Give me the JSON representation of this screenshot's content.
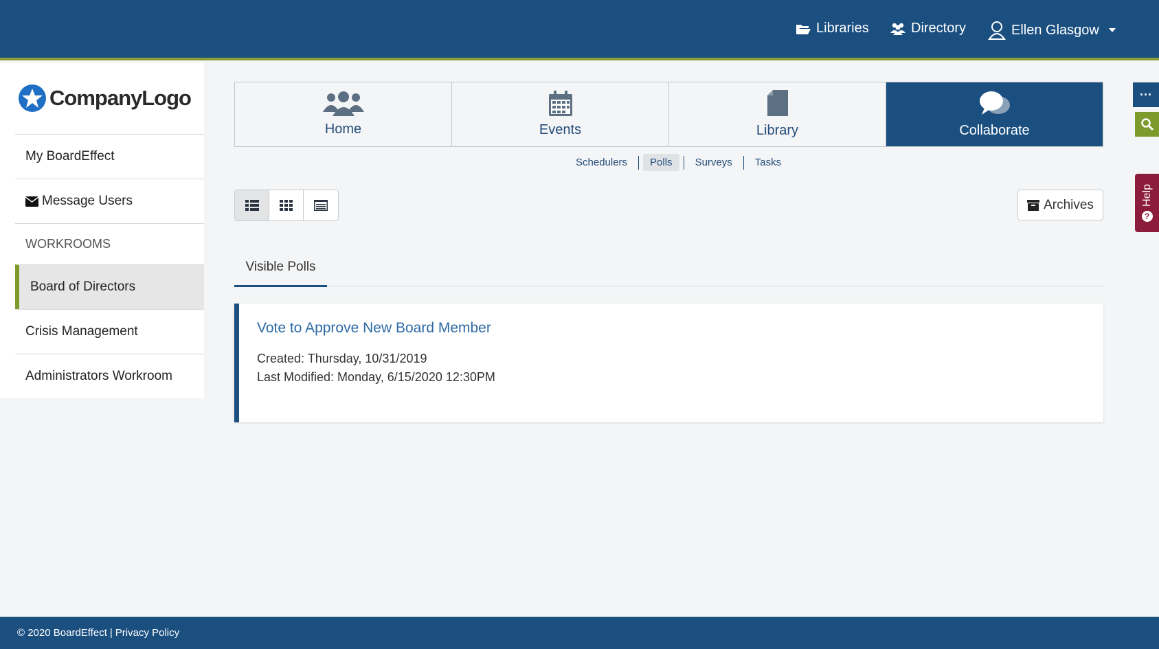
{
  "colors": {
    "brand_blue": "#1b4f80",
    "accent_green": "#7d9a2c",
    "help_red": "#8c1d3a",
    "link_blue": "#2d6aa6"
  },
  "header": {
    "libraries_label": "Libraries",
    "libraries_icon": "folder-open-icon",
    "directory_label": "Directory",
    "directory_icon": "users-icon",
    "user_name": "Ellen Glasgow",
    "user_icon": "user-outline-icon"
  },
  "sidebar": {
    "logo_text": "CompanyLogo",
    "my_boardeffect": "My BoardEffect",
    "message_users": "Message Users",
    "workrooms_heading": "WORKROOMS",
    "workrooms": [
      {
        "label": "Board of Directors",
        "active": true
      },
      {
        "label": "Crisis Management",
        "active": false
      },
      {
        "label": "Administrators Workroom",
        "active": false
      }
    ]
  },
  "main_tabs": [
    {
      "label": "Home",
      "icon": "group-icon",
      "active": false
    },
    {
      "label": "Events",
      "icon": "calendar-icon",
      "active": false
    },
    {
      "label": "Library",
      "icon": "document-icon",
      "active": false
    },
    {
      "label": "Collaborate",
      "icon": "chat-bubbles-icon",
      "active": true
    }
  ],
  "subnav": {
    "items": [
      "Schedulers",
      "Polls",
      "Surveys",
      "Tasks"
    ],
    "active": "Polls"
  },
  "toolbar": {
    "views": [
      "list-view-icon",
      "grid-view-icon",
      "detail-view-icon"
    ],
    "archives_label": "Archives"
  },
  "polls": {
    "tab_label": "Visible Polls",
    "items": [
      {
        "title": "Vote to Approve New Board Member",
        "created": "Created: Thursday, 10/31/2019",
        "modified": "Last Modified: Monday, 6/15/2020 12:30PM"
      }
    ]
  },
  "side_widgets": {
    "more_label": "···",
    "help_label": "Help"
  },
  "footer": {
    "copyright": "© 2020 BoardEffect",
    "separator": "|",
    "privacy": "Privacy Policy"
  }
}
